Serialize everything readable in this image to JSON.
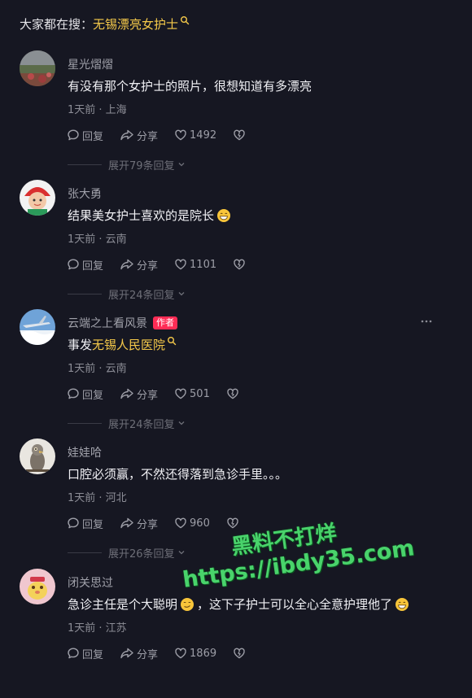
{
  "search": {
    "prefix": "大家都在搜：",
    "keyword": "无锡漂亮女护士"
  },
  "labels": {
    "reply": "回复",
    "share": "分享"
  },
  "comments": [
    {
      "username": "星光熠熠",
      "text": "有没有那个女护士的照片，很想知道有多漂亮",
      "meta": "1天前 · 上海",
      "likes": "1492",
      "expand": "展开79条回复"
    },
    {
      "username": "张大勇",
      "text": "结果美女护士喜欢的是院长",
      "meta": "1天前 · 云南",
      "likes": "1101",
      "expand": "展开24条回复"
    },
    {
      "username": "云端之上看风景",
      "badge": "作者",
      "text_prefix": "事发",
      "text_link": "无锡人民医院",
      "meta": "1天前 · 云南",
      "likes": "501",
      "expand": "展开24条回复"
    },
    {
      "username": "娃娃哈",
      "text": "口腔必须赢，不然还得落到急诊手里。。。",
      "meta": "1天前 · 河北",
      "likes": "960",
      "expand": "展开26条回复"
    },
    {
      "username": "闭关思过",
      "text_part1": "急诊主任是个大聪明",
      "text_part2": "，这下子护士可以全心全意护理他了",
      "meta": "1天前 · 江苏",
      "likes": "1869"
    }
  ],
  "watermark": {
    "line1": "黑料不打烊",
    "line2": "https://ibdy35.com"
  },
  "colors": {
    "background": "#161722",
    "keyword": "#f5c94a",
    "badge": "#fe2c55",
    "watermark": "#49d36b"
  }
}
